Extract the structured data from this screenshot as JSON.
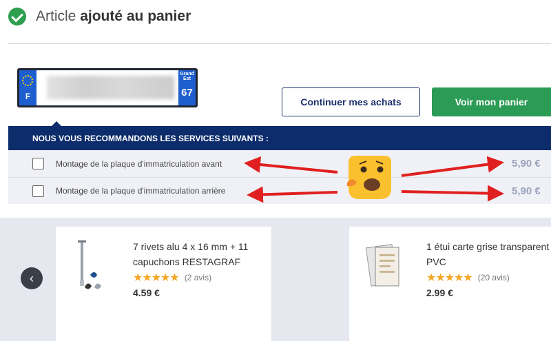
{
  "header": {
    "title_prefix": "Article",
    "title_bold": "ajouté au panier"
  },
  "plate": {
    "country": "F",
    "region_line1": "Grand",
    "region_line2": "Est",
    "region_number": "67"
  },
  "buttons": {
    "continue": "Continuer mes achats",
    "view_cart": "Voir mon panier"
  },
  "services": {
    "heading": "NOUS VOUS RECOMMANDONS LES SERVICES SUIVANTS :",
    "items": [
      {
        "label": "Montage de la plaque d'immatriculation avant",
        "price": "5,90 €"
      },
      {
        "label": "Montage de la plaque d'immatriculation arrière",
        "price": "5,90 €"
      }
    ]
  },
  "carousel": {
    "prev_icon": "‹",
    "products": [
      {
        "name_line1": "7 rivets alu 4 x 16 mm + 11",
        "name_line2": "capuchons RESTAGRAF",
        "stars": "★★★★★",
        "reviews": "(2 avis)",
        "price": "4.59 €"
      },
      {
        "name_line1": "1 étui carte grise transparent",
        "name_line2": "PVC",
        "stars": "★★★★★",
        "reviews": "(20 avis)",
        "price": "2.99 €"
      }
    ]
  },
  "colors": {
    "accent_green": "#2c9b55",
    "navy": "#0c2c6b",
    "arrow_red": "#e02020",
    "star": "#f5a623"
  }
}
